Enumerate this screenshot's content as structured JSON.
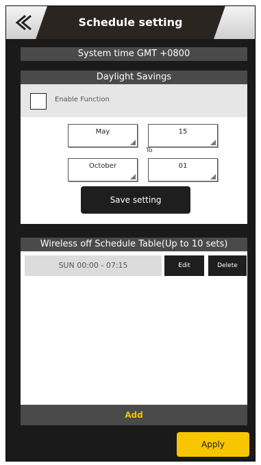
{
  "header": {
    "title": "Schedule setting",
    "back_icon": "chevron-double-left-icon"
  },
  "system_time": "System time GMT +0800",
  "daylight": {
    "section_title": "Daylight Savings",
    "enable_label": "Enable Function",
    "enabled": false,
    "start_month": "May",
    "start_day": "15",
    "to_label": "To",
    "end_month": "October",
    "end_day": "01",
    "save_label": "Save setting"
  },
  "schedule": {
    "section_title": "Wireless off Schedule Table(Up to 10 sets)",
    "entries": [
      {
        "text": "SUN 00:00 - 07:15",
        "edit_label": "Edit",
        "delete_label": "Delete"
      }
    ],
    "add_label": "Add"
  },
  "apply_label": "Apply",
  "colors": {
    "accent": "#f7c600",
    "bar": "#4a4a4a",
    "background": "#1a1a1a"
  }
}
